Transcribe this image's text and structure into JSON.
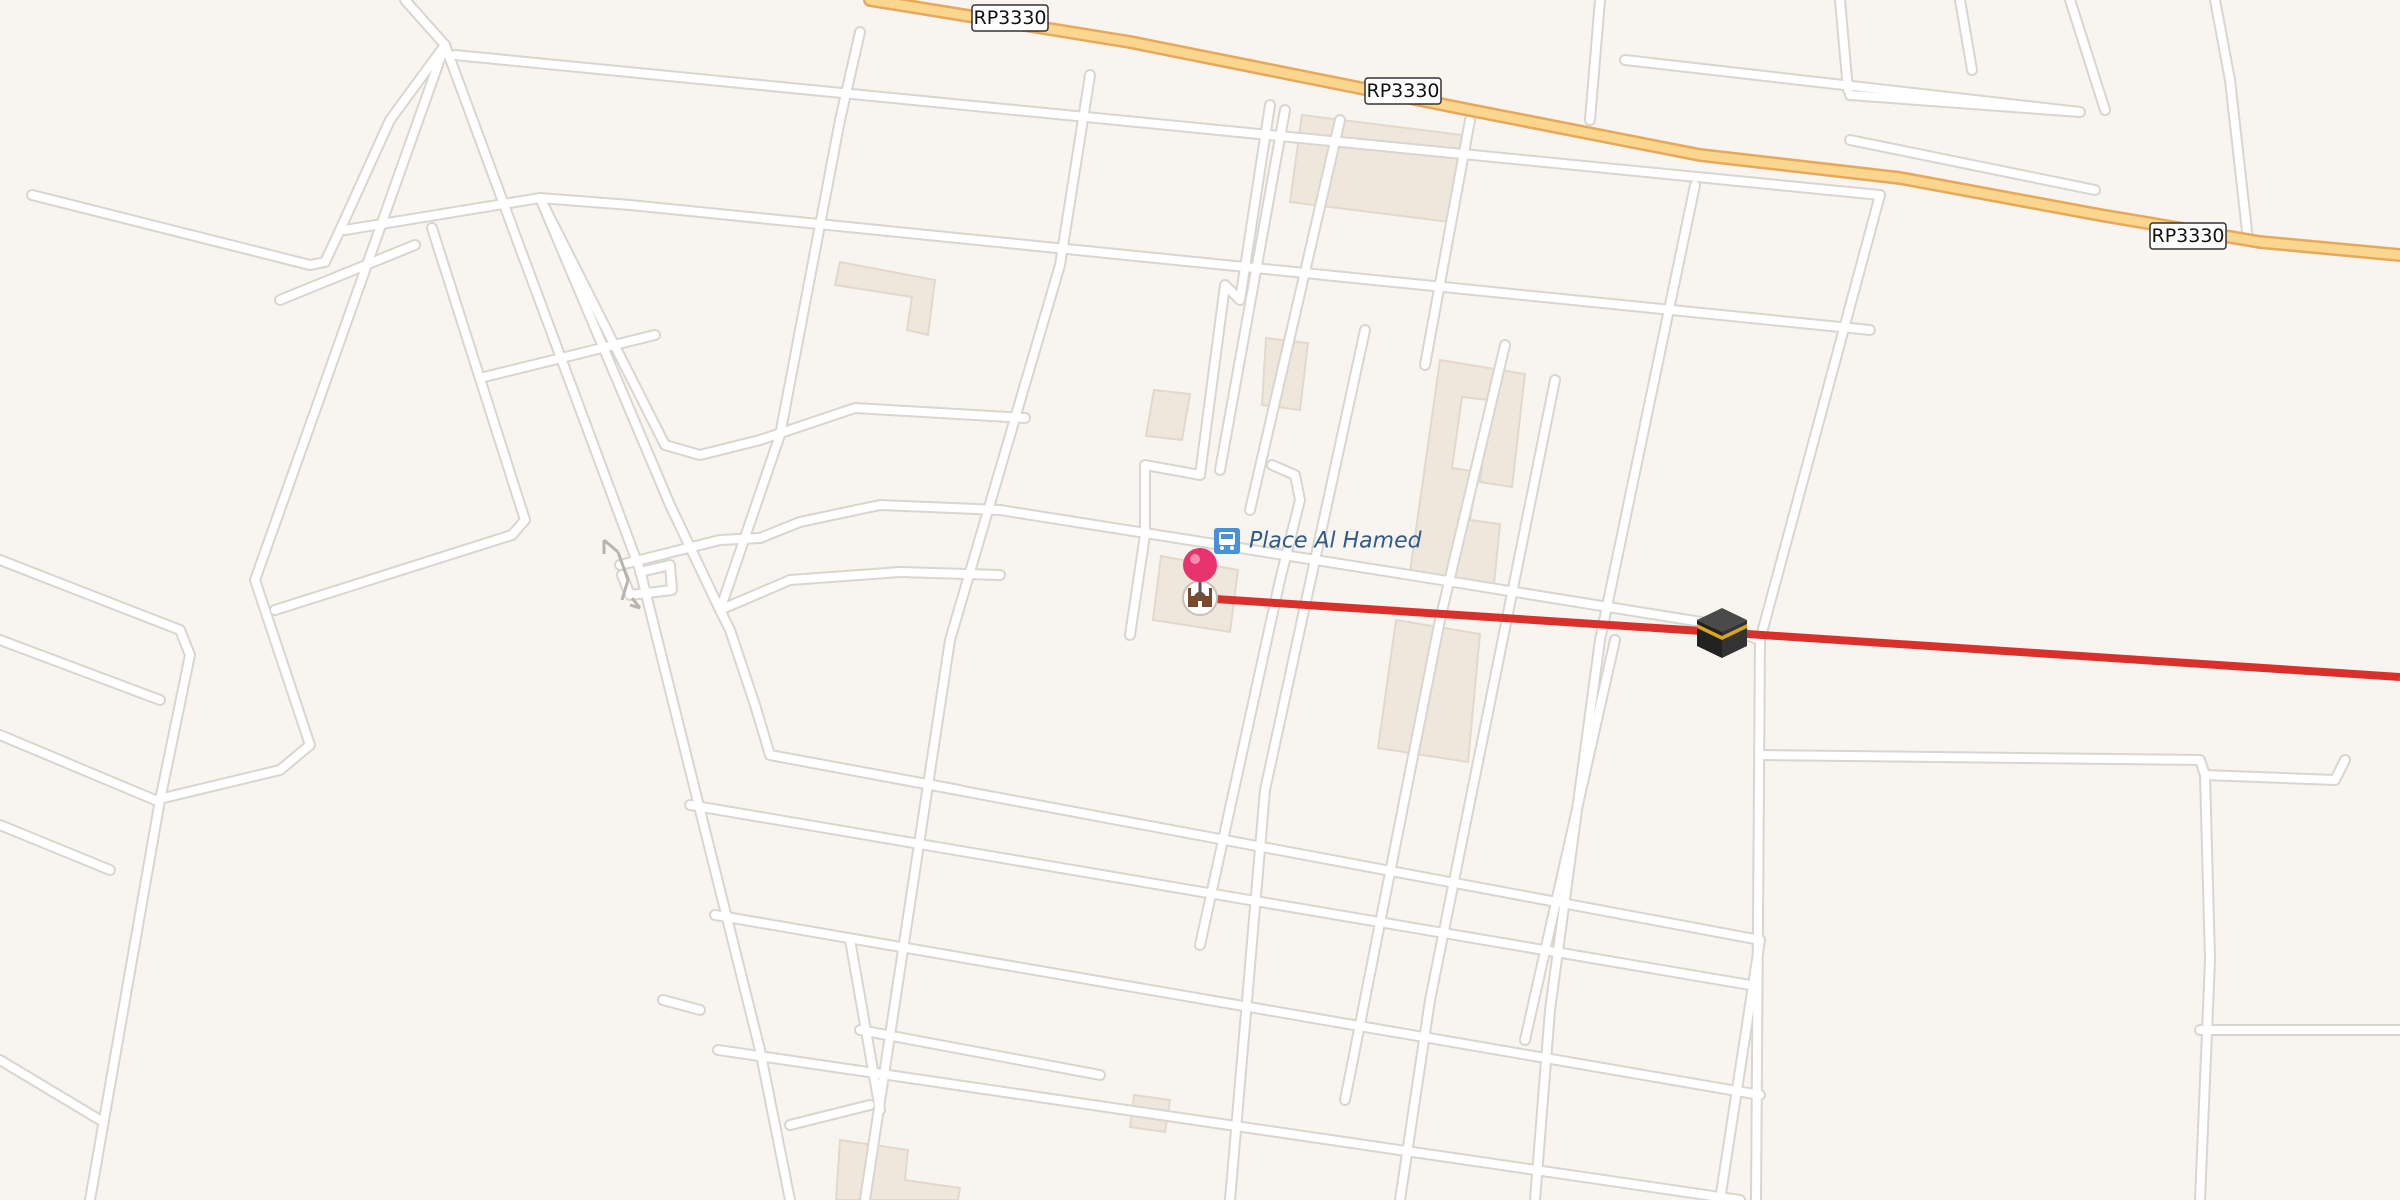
{
  "map": {
    "background_color": "#f8f5f1",
    "road_color": "#ffffff",
    "road_casing_color": "#d9d5d0",
    "building_color": "#efe6dc",
    "highway_color": "#fbd68f",
    "highway_casing_color": "#e8a85a",
    "route_color": "#d9302b"
  },
  "highway": {
    "name": "RP3330",
    "shields": [
      "RP3330",
      "RP3330",
      "RP3330"
    ]
  },
  "poi": {
    "bus_stop_icon": "bus-stop-icon",
    "bus_stop_name": "Place Al Hamed",
    "bus_stop_label_color": "#2f5a8a",
    "mosque_icon": "mosque-icon",
    "location_pin_icon": "location-pin-icon",
    "location_pin_color": "#e8336f",
    "kaaba_icon": "kaaba-icon"
  }
}
